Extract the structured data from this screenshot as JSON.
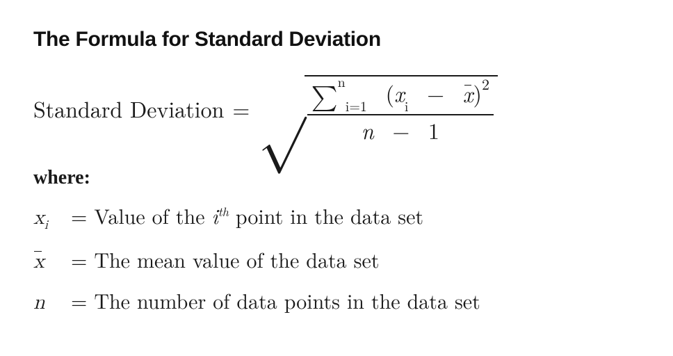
{
  "title": "The Formula for Standard Deviation",
  "formula": {
    "lhs": "Standard Deviation",
    "equals": "=",
    "sum_symbol": "∑",
    "sum_lower": "i=1",
    "sum_upper": "n",
    "x": "x",
    "i": "i",
    "minus": "−",
    "xbar": "x",
    "square": "2",
    "n": "n",
    "one": "1",
    "lparen": "(",
    "rparen": ")"
  },
  "where_label": "where:",
  "defs": {
    "xi": {
      "sym_x": "x",
      "sym_i": "i",
      "eq": "=",
      "text_a": "Value of the ",
      "ith_i": "i",
      "ith_th": "th",
      "text_b": " point in the data set"
    },
    "xbar": {
      "sym": "x",
      "eq": "=",
      "text": "The mean value of the data set"
    },
    "n": {
      "sym": "n",
      "eq": "=",
      "text": "The number of data points in the data set"
    }
  }
}
